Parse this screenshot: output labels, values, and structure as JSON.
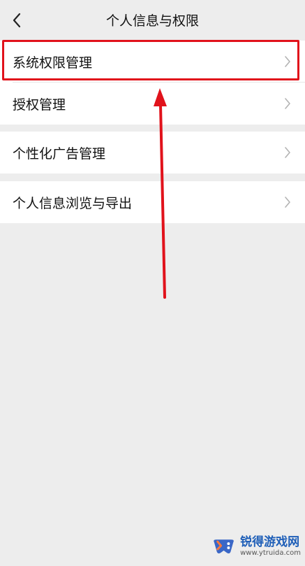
{
  "header": {
    "title": "个人信息与权限",
    "back_icon": "chevron-left-icon"
  },
  "groups": [
    {
      "items": [
        {
          "label": "系统权限管理"
        },
        {
          "label": "授权管理"
        }
      ]
    },
    {
      "items": [
        {
          "label": "个性化广告管理"
        }
      ]
    },
    {
      "items": [
        {
          "label": "个人信息浏览与导出"
        }
      ]
    }
  ],
  "annotation": {
    "highlight_color": "#e1121b",
    "arrow_color": "#e1121b"
  },
  "watermark": {
    "brand": "锐得游戏网",
    "url": "www.ytruida.com"
  },
  "colors": {
    "background": "#ededed",
    "card": "#ffffff",
    "text": "#111111",
    "chevron": "#b2b2b2"
  }
}
